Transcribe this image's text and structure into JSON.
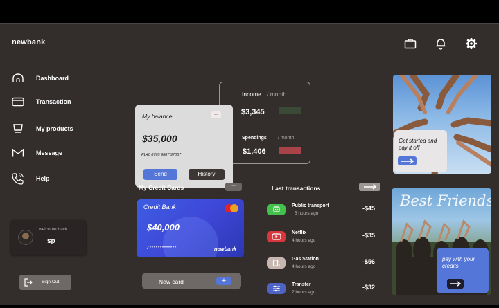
{
  "app": {
    "logo": "newbank"
  },
  "header": {
    "icons": [
      "briefcase-icon",
      "bell-icon",
      "gear-icon"
    ]
  },
  "sidebar": {
    "items": [
      {
        "label": "Dashboard",
        "icon": "home-icon"
      },
      {
        "label": "Transaction",
        "icon": "card-icon"
      },
      {
        "label": "My products",
        "icon": "cart-icon"
      },
      {
        "label": "Message",
        "icon": "mail-icon"
      },
      {
        "label": "Help",
        "icon": "phone-icon"
      }
    ],
    "welcome": {
      "greeting": "welcome back",
      "username": "sp"
    },
    "signout_label": "Sign Out"
  },
  "balance": {
    "title": "My balance",
    "menu": "...",
    "amount": "$35,000",
    "account_number": "PL40 8765 9887 97867",
    "send_label": "Send",
    "history_label": "History"
  },
  "income": {
    "income_label": "Income",
    "period": "/ month",
    "income_value": "$3,345",
    "spendings_label": "Spendings",
    "period2": "/ month",
    "spendings_value": "$1,406",
    "income_color": "#3a4a37",
    "spendings_color": "#a84449"
  },
  "cards": {
    "title": "My  Credit Cards",
    "menu": "...",
    "card": {
      "bank": "Credit Bank",
      "amount": "$40,000",
      "number": "7*************",
      "brand": "newbank"
    },
    "new_card_label": "New card",
    "new_card_plus": "+"
  },
  "transactions": {
    "title": "Last transactions",
    "items": [
      {
        "name": "Public transport",
        "time": "5 hours ago",
        "amount": "-$45",
        "icon": "transport-icon",
        "color": "#46c04c"
      },
      {
        "name": "Netflix",
        "time": "4 hours ago",
        "amount": "-$35",
        "icon": "play-icon",
        "color": "#d8383d"
      },
      {
        "name": "Gas Station",
        "time": "4 hours ago",
        "amount": "-$56",
        "icon": "fuel-icon",
        "color": "#c8b7b1"
      },
      {
        "name": "Transfer",
        "time": "7 hours ago",
        "amount": "-$32",
        "icon": "sliders-icon",
        "color": "#4e63c4"
      }
    ]
  },
  "promos": [
    {
      "text": "Get started and pay it off"
    },
    {
      "heading": "Best Friends",
      "text": "pay with your credits"
    }
  ],
  "colors": {
    "accent": "#5476d8",
    "background": "#332d2c"
  }
}
